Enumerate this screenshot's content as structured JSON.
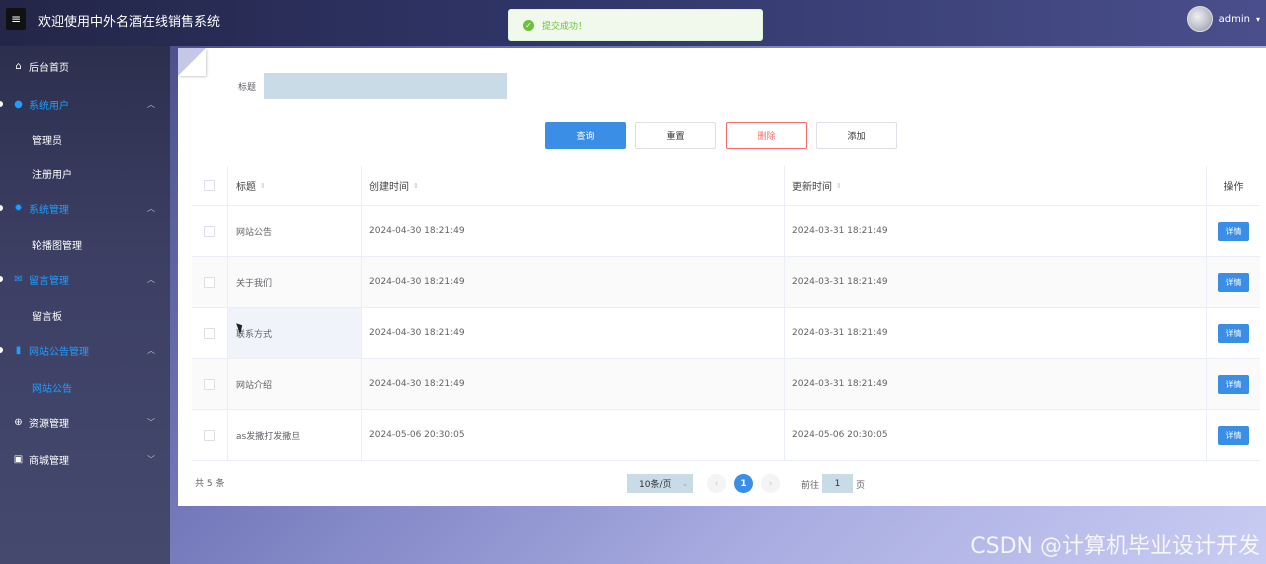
{
  "header": {
    "menu_icon": "menu-icon",
    "title": "欢迎使用中外名酒在线销售系统",
    "user": "admin",
    "caret": "⌄"
  },
  "toast": {
    "icon": "check-circle-icon",
    "text": "提交成功！"
  },
  "sidebar": {
    "items": [
      {
        "label": "后台首页",
        "icon": "home-icon"
      },
      {
        "label": "系统用户",
        "icon": "user-icon"
      },
      {
        "label": "管理员"
      },
      {
        "label": "注册用户"
      },
      {
        "label": "系统管理",
        "icon": "gear-icon"
      },
      {
        "label": "轮播图管理"
      },
      {
        "label": "留言管理",
        "icon": "message-icon"
      },
      {
        "label": "留言板"
      },
      {
        "label": "网站公告管理",
        "icon": "notice-icon"
      },
      {
        "label": "网站公告"
      },
      {
        "label": "资源管理",
        "icon": "plus-circle-icon"
      },
      {
        "label": "商城管理",
        "icon": "shop-icon"
      }
    ]
  },
  "search": {
    "label": "标题",
    "value": ""
  },
  "toolbar": {
    "query": "查询",
    "reset": "重置",
    "delete": "删除",
    "add": "添加"
  },
  "table": {
    "headers": {
      "title": "标题",
      "created": "创建时间",
      "updated": "更新时间",
      "op": "操作"
    },
    "rows": [
      {
        "title": "网站公告",
        "created": "2024-04-30 18:21:49",
        "updated": "2024-03-31 18:21:49",
        "action": "详情"
      },
      {
        "title": "关于我们",
        "created": "2024-04-30 18:21:49",
        "updated": "2024-03-31 18:21:49",
        "action": "详情"
      },
      {
        "title": "联系方式",
        "created": "2024-04-30 18:21:49",
        "updated": "2024-03-31 18:21:49",
        "action": "详情"
      },
      {
        "title": "网站介绍",
        "created": "2024-04-30 18:21:49",
        "updated": "2024-03-31 18:21:49",
        "action": "详情"
      },
      {
        "title": "as发撒打发撒旦",
        "created": "2024-05-06 20:30:05",
        "updated": "2024-05-06 20:30:05",
        "action": "详情"
      }
    ]
  },
  "pagination": {
    "total": "共 5 条",
    "page_size": "10条/页",
    "current": "1",
    "goto_label": "前往",
    "goto_value": "1",
    "goto_suffix": "页"
  },
  "watermark": "CSDN @计算机毕业设计开发"
}
